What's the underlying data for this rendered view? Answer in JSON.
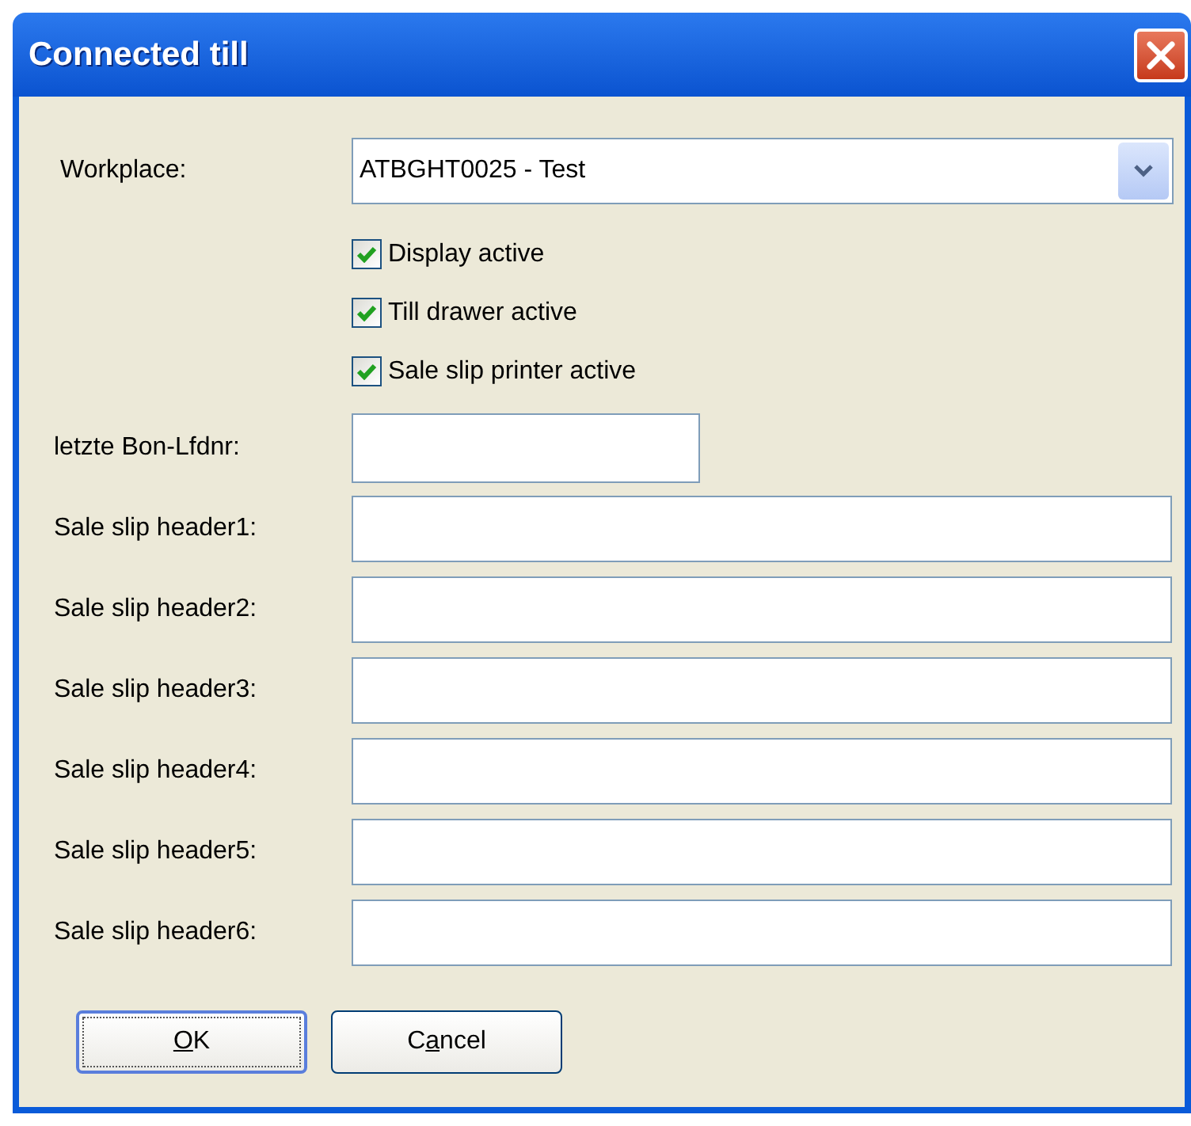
{
  "window": {
    "title": "Connected till"
  },
  "workplace": {
    "label": "Workplace:",
    "value": "ATBGHT0025 - Test"
  },
  "checkboxes": [
    {
      "label": "Display active",
      "checked": true
    },
    {
      "label": "Till drawer active",
      "checked": true
    },
    {
      "label": "Sale slip printer active",
      "checked": true
    }
  ],
  "fields": [
    {
      "kind": "short",
      "label": "letzte Bon-Lfdnr:"
    },
    {
      "kind": "long",
      "label": "Sale slip header1:"
    },
    {
      "kind": "long",
      "label": "Sale slip header2:"
    },
    {
      "kind": "long",
      "label": "Sale slip header3:"
    },
    {
      "kind": "long",
      "label": "Sale slip header4:"
    },
    {
      "kind": "long",
      "label": "Sale slip header5:"
    },
    {
      "kind": "long",
      "label": "Sale slip header6:"
    }
  ],
  "buttons": [
    {
      "key": "O",
      "after": "K",
      "focused": true
    },
    {
      "before": "C",
      "key": "a",
      "after": "ncel",
      "focused": false
    }
  ]
}
